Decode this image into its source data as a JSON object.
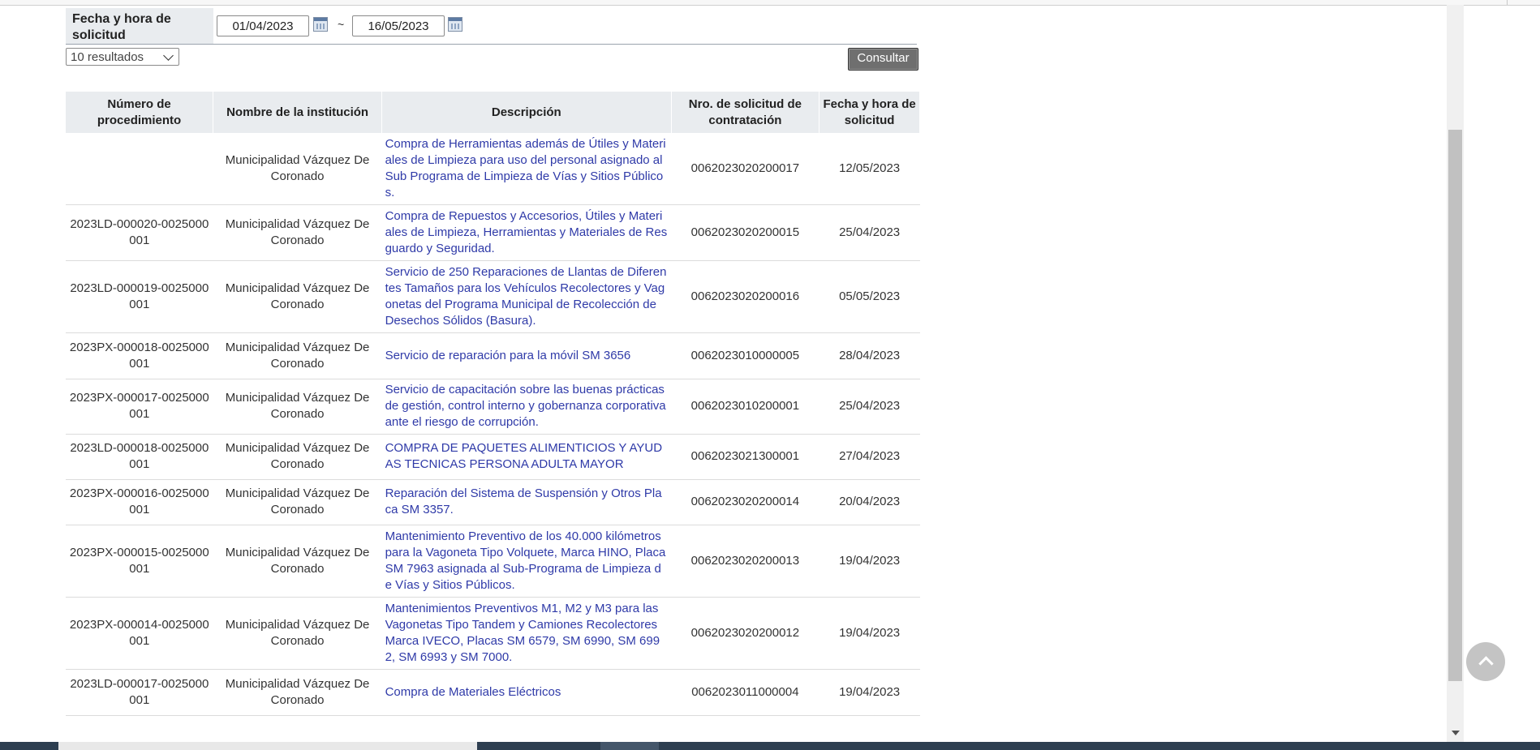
{
  "filter": {
    "label": "Fecha y hora de solicitud",
    "date_from": "01/04/2023",
    "separator": "~",
    "date_to": "16/05/2023"
  },
  "results_select": {
    "value": "10 resultados"
  },
  "consult_button": {
    "label": "Consultar"
  },
  "table": {
    "headers": [
      "Número de procedimiento",
      "Nombre de la institución",
      "Descripción",
      "Nro. de solicitud de contratación",
      "Fecha y hora de solicitud"
    ],
    "rows": [
      {
        "procedure": "",
        "institution": "Municipalidad Vázquez De Coronado",
        "description": "Compra de Herramientas además de Útiles y Materiales de Limpieza para uso del personal asignado al Sub Programa de Limpieza de Vías y Sitios Públicos.",
        "request_no": "0062023020200017",
        "date": "12/05/2023"
      },
      {
        "procedure": "2023LD-000020-0025000001",
        "institution": "Municipalidad Vázquez De Coronado",
        "description": "Compra de Repuestos y Accesorios, Útiles y Materiales de Limpieza, Herramientas y Materiales de Resguardo y Seguridad.",
        "request_no": "0062023020200015",
        "date": "25/04/2023"
      },
      {
        "procedure": "2023LD-000019-0025000001",
        "institution": "Municipalidad Vázquez De Coronado",
        "description": "Servicio de 250 Reparaciones de Llantas de Diferentes Tamaños para los Vehículos Recolectores y Vagonetas del Programa Municipal de Recolección de Desechos Sólidos (Basura).",
        "request_no": "0062023020200016",
        "date": "05/05/2023"
      },
      {
        "procedure": "2023PX-000018-0025000001",
        "institution": "Municipalidad Vázquez De Coronado",
        "description": "Servicio de reparación para la móvil SM 3656",
        "request_no": "0062023010000005",
        "date": "28/04/2023"
      },
      {
        "procedure": "2023PX-000017-0025000001",
        "institution": "Municipalidad Vázquez De Coronado",
        "description": "Servicio de capacitación sobre las buenas prácticas de gestión, control interno y gobernanza corporativa ante el riesgo de corrupción.",
        "request_no": "0062023010200001",
        "date": "25/04/2023"
      },
      {
        "procedure": "2023LD-000018-0025000001",
        "institution": "Municipalidad Vázquez De Coronado",
        "description": "COMPRA DE PAQUETES ALIMENTICIOS Y AYUDAS TECNICAS PERSONA ADULTA MAYOR",
        "request_no": "0062023021300001",
        "date": "27/04/2023"
      },
      {
        "procedure": "2023PX-000016-0025000001",
        "institution": "Municipalidad Vázquez De Coronado",
        "description": "Reparación del Sistema de Suspensión y Otros Placa SM 3357.",
        "request_no": "0062023020200014",
        "date": "20/04/2023"
      },
      {
        "procedure": "2023PX-000015-0025000001",
        "institution": "Municipalidad Vázquez De Coronado",
        "description": "Mantenimiento Preventivo de los 40.000 kilómetros para la Vagoneta Tipo Volquete, Marca HINO, Placa SM 7963 asignada al Sub-Programa de Limpieza de Vías y Sitios Públicos.",
        "request_no": "0062023020200013",
        "date": "19/04/2023"
      },
      {
        "procedure": "2023PX-000014-0025000001",
        "institution": "Municipalidad Vázquez De Coronado",
        "description": "Mantenimientos Preventivos M1, M2 y M3 para las Vagonetas Tipo Tandem y Camiones Recolectores Marca IVECO, Placas SM 6579, SM 6990, SM 6992, SM 6993 y SM 7000.",
        "request_no": "0062023020200012",
        "date": "19/04/2023"
      },
      {
        "procedure": "2023LD-000017-0025000001",
        "institution": "Municipalidad Vázquez De Coronado",
        "description": "Compra de Materiales Eléctricos",
        "request_no": "0062023011000004",
        "date": "19/04/2023"
      }
    ]
  },
  "icons": {
    "calendar": "calendar-icon",
    "scroll_top": "chevron-up-icon",
    "scroll_down": "caret-down-icon"
  }
}
